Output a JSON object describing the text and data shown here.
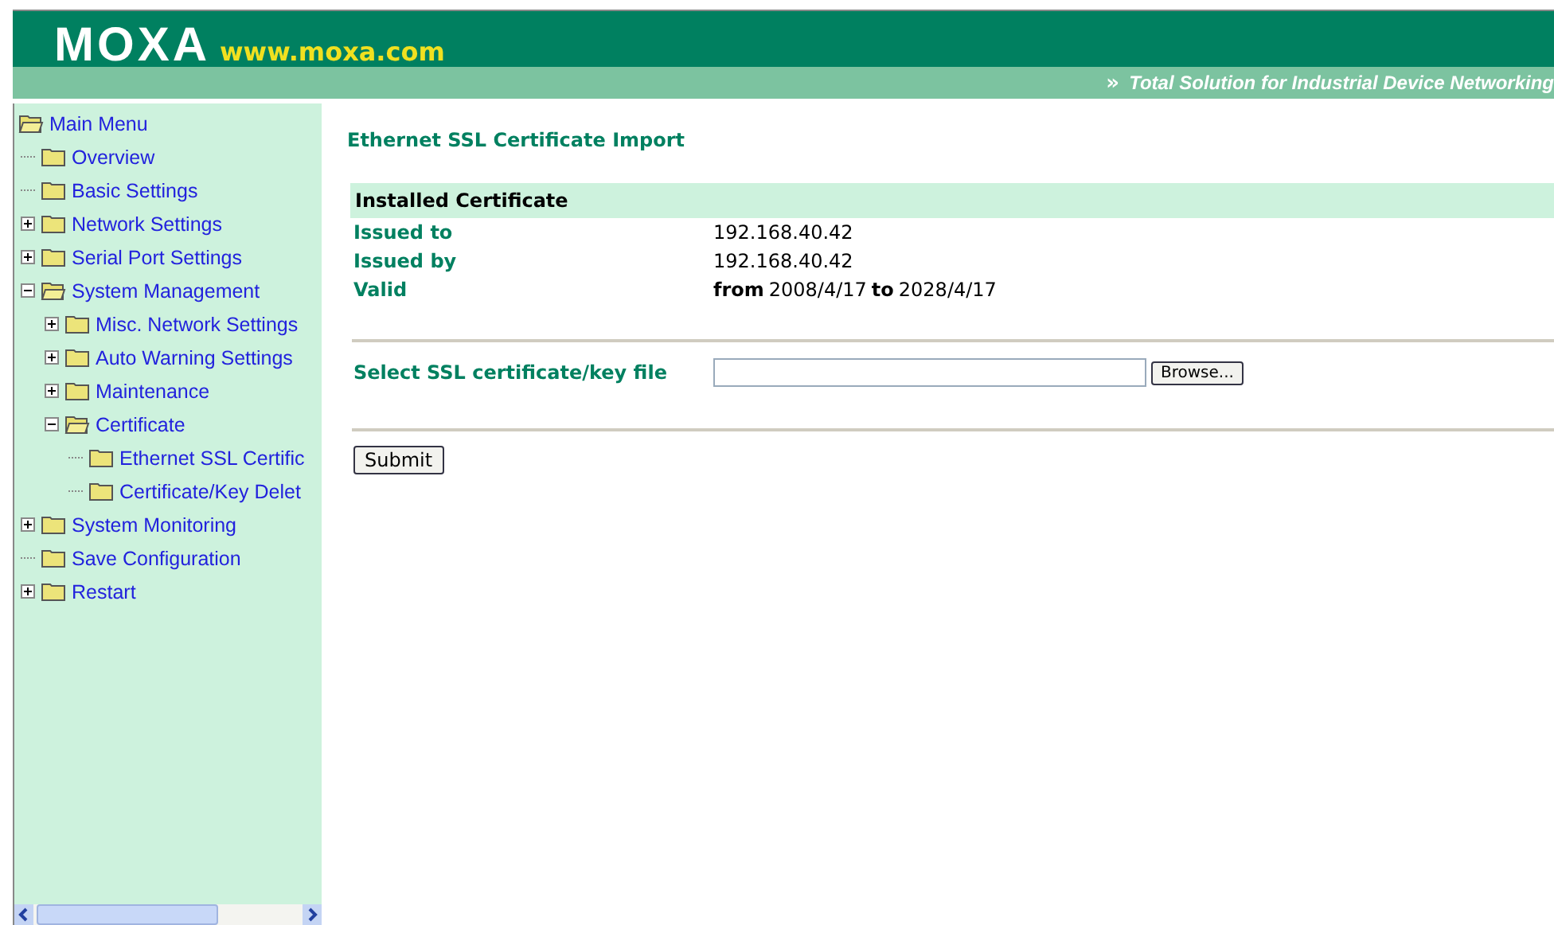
{
  "header": {
    "logo": "MOXA",
    "url": "www.moxa.com",
    "tagline_icon": "»",
    "tagline": "Total Solution for Industrial Device Networking"
  },
  "sidebar": {
    "root": "Main Menu",
    "items": [
      {
        "label": "Overview",
        "kind": "leaf"
      },
      {
        "label": "Basic Settings",
        "kind": "leaf"
      },
      {
        "label": "Network Settings",
        "kind": "branch",
        "expanded": false
      },
      {
        "label": "Serial Port Settings",
        "kind": "branch",
        "expanded": false
      },
      {
        "label": "System Management",
        "kind": "branch",
        "expanded": true,
        "children": [
          {
            "label": "Misc. Network Settings",
            "kind": "branch",
            "expanded": false
          },
          {
            "label": "Auto Warning Settings",
            "kind": "branch",
            "expanded": false
          },
          {
            "label": "Maintenance",
            "kind": "branch",
            "expanded": false
          },
          {
            "label": "Certificate",
            "kind": "branch",
            "expanded": true,
            "children": [
              {
                "label": "Ethernet SSL Certific",
                "kind": "leaf"
              },
              {
                "label": "Certificate/Key Delet",
                "kind": "leaf"
              }
            ]
          }
        ]
      },
      {
        "label": "System Monitoring",
        "kind": "branch",
        "expanded": false
      },
      {
        "label": "Save Configuration",
        "kind": "leaf"
      },
      {
        "label": "Restart",
        "kind": "branch",
        "expanded": false
      }
    ]
  },
  "page": {
    "title": "Ethernet SSL Certificate Import",
    "installed": {
      "heading": "Installed Certificate",
      "rows": [
        {
          "label": "Issued to",
          "value": "192.168.40.42"
        },
        {
          "label": "Issued by",
          "value": "192.168.40.42"
        },
        {
          "label": "Valid",
          "value": "**from** 2008/4/17 **to** 2028/4/17"
        }
      ]
    },
    "file_field": {
      "label": "Select SSL certificate/key file",
      "browse": "Browse..."
    },
    "submit": "Submit"
  }
}
